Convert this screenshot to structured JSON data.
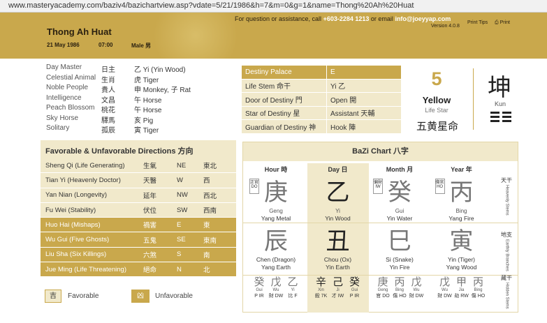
{
  "browser": {
    "url": "www.masteryacademy.com/baziv4/bazichartview.asp?vdate=5/21/1986&h=7&m=0&g=1&name=Thong%20Ah%20Huat"
  },
  "header": {
    "name": "Thong Ah Huat",
    "date": "21 May 1986",
    "time": "07:00",
    "gender": "Male 男",
    "contact_prefix": "For question or assistance, call",
    "phone": "+603-2284 1213",
    "contact_mid": "or email",
    "email": "info@joeyyap.com",
    "version": "Version 4.0.8",
    "print_tips": "Print Tips",
    "print": "Print"
  },
  "profile": [
    {
      "label": "Day Master",
      "chinese": "日主",
      "value": "乙 Yi (Yin Wood)"
    },
    {
      "label": "Celestial Animal",
      "chinese": "生肖",
      "value": "虎 Tiger"
    },
    {
      "label": "Noble People",
      "chinese": "貴人",
      "value": "申 Monkey, 子 Rat"
    },
    {
      "label": "Intelligence",
      "chinese": "文昌",
      "value": "午 Horse"
    },
    {
      "label": "Peach Blossom",
      "chinese": "桃花",
      "value": "午 Horse"
    },
    {
      "label": "Sky Horse",
      "chinese": "驛馬",
      "value": "亥 Pig"
    },
    {
      "label": "Solitary",
      "chinese": "孤辰",
      "value": "寅 Tiger"
    }
  ],
  "destiny": {
    "header_label": "Destiny Palace",
    "header_value": "E",
    "rows": [
      {
        "label": "Life Stem 命干",
        "value": "Yi 乙"
      },
      {
        "label": "Door of Destiny 門",
        "value": "Open 開"
      },
      {
        "label": "Star of Destiny 星",
        "value": "Assistant 天輔"
      },
      {
        "label": "Guardian of Destiny 神",
        "value": "Hook 陣"
      }
    ]
  },
  "life_star": {
    "number": "5",
    "color": "Yellow",
    "sub": "Life Star",
    "chinese": "五黄星命"
  },
  "gua": {
    "char": "坤",
    "name": "Kun"
  },
  "directions": {
    "title": "Favorable & Unfavorable Directions 方向",
    "rows": [
      {
        "name": "Sheng Qi (Life Generating)",
        "chinese": "生氣",
        "dir": "NE",
        "dir_cn": "東北",
        "favorable": true
      },
      {
        "name": "Tian Yi (Heavenly Doctor)",
        "chinese": "天醫",
        "dir": "W",
        "dir_cn": "西",
        "favorable": true
      },
      {
        "name": "Yan Nian (Longevity)",
        "chinese": "延年",
        "dir": "NW",
        "dir_cn": "西北",
        "favorable": true
      },
      {
        "name": "Fu Wei (Stability)",
        "chinese": "伏位",
        "dir": "SW",
        "dir_cn": "西南",
        "favorable": true
      },
      {
        "name": "Huo Hai (Mishaps)",
        "chinese": "禍害",
        "dir": "E",
        "dir_cn": "東",
        "favorable": false
      },
      {
        "name": "Wu Gui (Five Ghosts)",
        "chinese": "五鬼",
        "dir": "SE",
        "dir_cn": "東南",
        "favorable": false
      },
      {
        "name": "Liu Sha (Six Killings)",
        "chinese": "六煞",
        "dir": "S",
        "dir_cn": "南",
        "favorable": false
      },
      {
        "name": "Jue Ming (Life Threatening)",
        "chinese": "絕命",
        "dir": "N",
        "dir_cn": "北",
        "favorable": false
      }
    ],
    "legend": {
      "fav_char": "吉",
      "fav_label": "Favorable",
      "unfav_char": "凶",
      "unfav_label": "Unfavorable"
    }
  },
  "bazi": {
    "title": "BaZi Chart 八字",
    "row_labels": [
      {
        "cn": "天干",
        "en": "Heavenly Stems"
      },
      {
        "cn": "地支",
        "en": "Earthly Branches"
      },
      {
        "cn": "藏干",
        "en": "Hidden Stems"
      }
    ],
    "pillars": [
      {
        "head": "Hour 時",
        "tag": "正官 DO",
        "stem": "庚",
        "stem_py": "Geng",
        "stem_el": "Yang Metal",
        "branch": "辰",
        "branch_py": "Chen (Dragon)",
        "branch_el": "Yang Earth",
        "hidden": [
          {
            "c": "癸",
            "p": "Gui",
            "s": "P IR"
          },
          {
            "c": "戊",
            "p": "Wu",
            "s": "財 DW"
          },
          {
            "c": "乙",
            "p": "Yi",
            "s": "比 F"
          }
        ]
      },
      {
        "head": "Day 日",
        "tag": "",
        "stem": "乙",
        "stem_py": "Yi",
        "stem_el": "Yin Wood",
        "branch": "丑",
        "branch_py": "Chou (Ox)",
        "branch_el": "Yin Earth",
        "hidden": [
          {
            "c": "辛",
            "p": "Xin",
            "s": "殺 7K"
          },
          {
            "c": "己",
            "p": "Ji",
            "s": "才 IW"
          },
          {
            "c": "癸",
            "p": "Gui",
            "s": "P IR"
          }
        ]
      },
      {
        "head": "Month 月",
        "tag": "偏財 IW",
        "stem": "癸",
        "stem_py": "Gui",
        "stem_el": "Yin Water",
        "branch": "巳",
        "branch_py": "Si (Snake)",
        "branch_el": "Yin Fire",
        "hidden": [
          {
            "c": "庚",
            "p": "Geng",
            "s": "官 DO"
          },
          {
            "c": "丙",
            "p": "Bing",
            "s": "傷 HO"
          },
          {
            "c": "戊",
            "p": "Wu",
            "s": "財 DW"
          }
        ]
      },
      {
        "head": "Year 年",
        "tag": "傷官 HO",
        "stem": "丙",
        "stem_py": "Bing",
        "stem_el": "Yang Fire",
        "branch": "寅",
        "branch_py": "Yin (Tiger)",
        "branch_el": "Yang Wood",
        "hidden": [
          {
            "c": "戊",
            "p": "Wu",
            "s": "財 DW"
          },
          {
            "c": "甲",
            "p": "Jia",
            "s": "劫 RW"
          },
          {
            "c": "丙",
            "p": "Bing",
            "s": "傷 HO"
          }
        ]
      }
    ]
  },
  "colors": {
    "accent": "#c9a84c",
    "light": "#f1e9cb"
  }
}
